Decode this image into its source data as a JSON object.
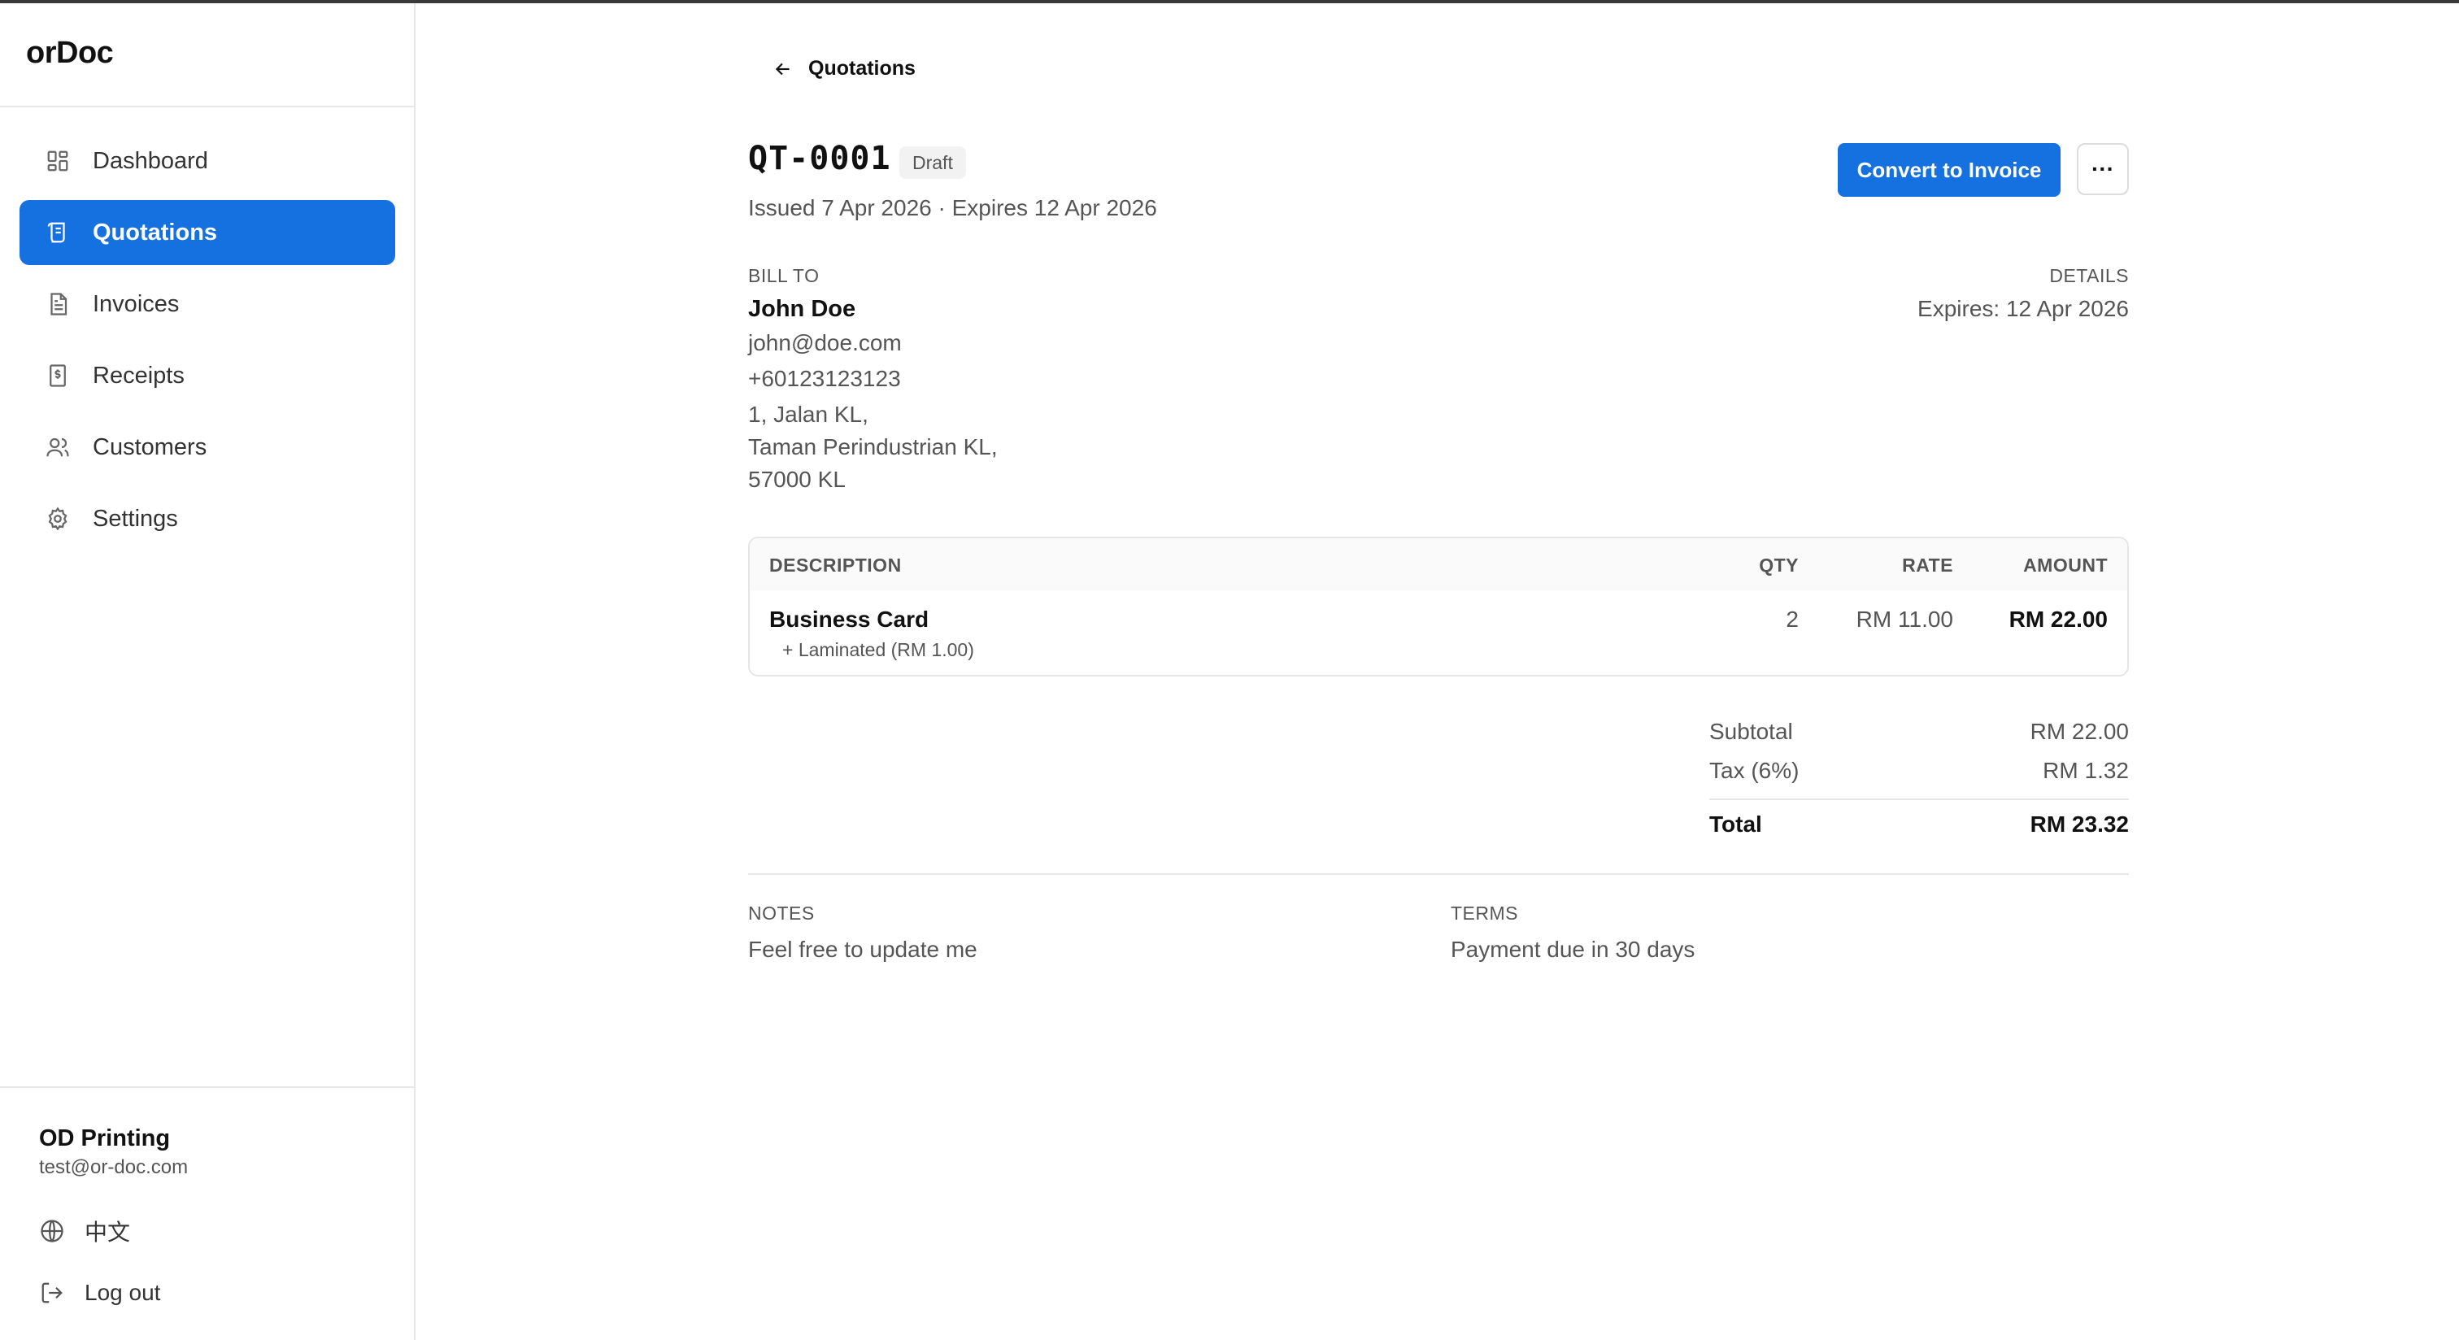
{
  "app": {
    "brand": "orDoc"
  },
  "sidebar": {
    "items": [
      {
        "label": "Dashboard",
        "icon": "dashboard-icon",
        "active": false
      },
      {
        "label": "Quotations",
        "icon": "quotations-icon",
        "active": true
      },
      {
        "label": "Invoices",
        "icon": "invoice-icon",
        "active": false
      },
      {
        "label": "Receipts",
        "icon": "receipt-icon",
        "active": false
      },
      {
        "label": "Customers",
        "icon": "customers-icon",
        "active": false
      },
      {
        "label": "Settings",
        "icon": "gear-icon",
        "active": false
      }
    ],
    "org_name": "OD Printing",
    "org_email": "test@or-doc.com",
    "language_label": "中文",
    "logout_label": "Log out"
  },
  "header": {
    "back_label": "Quotations",
    "number": "QT-0001",
    "status": "Draft",
    "issued_line": "Issued 7 Apr 2026 · Expires 12 Apr 2026",
    "convert_label": "Convert to Invoice",
    "more_label": "···"
  },
  "bill_to": {
    "label": "BILL TO",
    "name": "John Doe",
    "email": "john@doe.com",
    "phone": "+60123123123",
    "address": [
      "1, Jalan KL,",
      "Taman Perindustrian KL,",
      "57000 KL"
    ]
  },
  "details": {
    "label": "DETAILS",
    "expires": "Expires: 12 Apr 2026"
  },
  "table": {
    "headers": {
      "description": "DESCRIPTION",
      "qty": "QTY",
      "rate": "RATE",
      "amount": "AMOUNT"
    },
    "rows": [
      {
        "description": "Business Card",
        "option": "+ Laminated (RM 1.00)",
        "qty": "2",
        "rate": "RM 11.00",
        "amount": "RM 22.00"
      }
    ]
  },
  "totals": {
    "subtotal_label": "Subtotal",
    "subtotal": "RM 22.00",
    "tax_label": "Tax (6%)",
    "tax": "RM 1.32",
    "total_label": "Total",
    "total": "RM 23.32"
  },
  "notes": {
    "label": "NOTES",
    "text": "Feel free to update me"
  },
  "terms": {
    "label": "TERMS",
    "text": "Payment due in 30 days"
  },
  "colors": {
    "accent": "#1570e0",
    "muted": "#555555"
  }
}
